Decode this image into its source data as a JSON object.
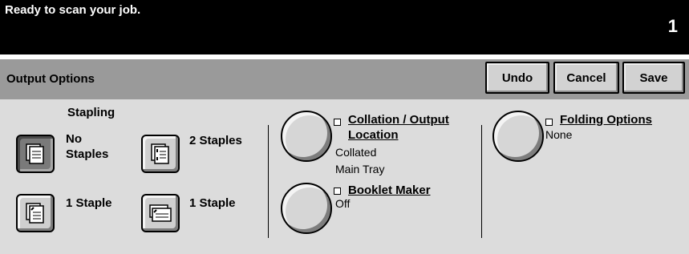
{
  "status": {
    "message": "Ready to scan your job.",
    "count": "1"
  },
  "header": {
    "title": "Output Options",
    "undo": "Undo",
    "cancel": "Cancel",
    "save": "Save"
  },
  "stapling": {
    "title": "Stapling",
    "options": [
      {
        "label_line1": "No",
        "label_line2": "Staples",
        "selected": true,
        "icon": "no-staples-icon"
      },
      {
        "label": "2 Staples",
        "selected": false,
        "icon": "two-staples-icon"
      },
      {
        "label": "1 Staple",
        "selected": false,
        "icon": "one-staple-portrait-icon"
      },
      {
        "label": "1 Staple",
        "selected": false,
        "icon": "one-staple-landscape-icon"
      }
    ]
  },
  "collation": {
    "title_line1": "Collation / Output",
    "title_line2": "Location",
    "value1": "Collated",
    "value2": "Main Tray"
  },
  "booklet": {
    "title": "Booklet Maker",
    "value": "Off"
  },
  "folding": {
    "title": "Folding Options",
    "value": "None"
  },
  "colors": {
    "status_bg": "#000000",
    "header_bg": "#9a9a9a",
    "panel_bg": "#dcdcdc",
    "selected_bg": "#7a7a7a"
  }
}
